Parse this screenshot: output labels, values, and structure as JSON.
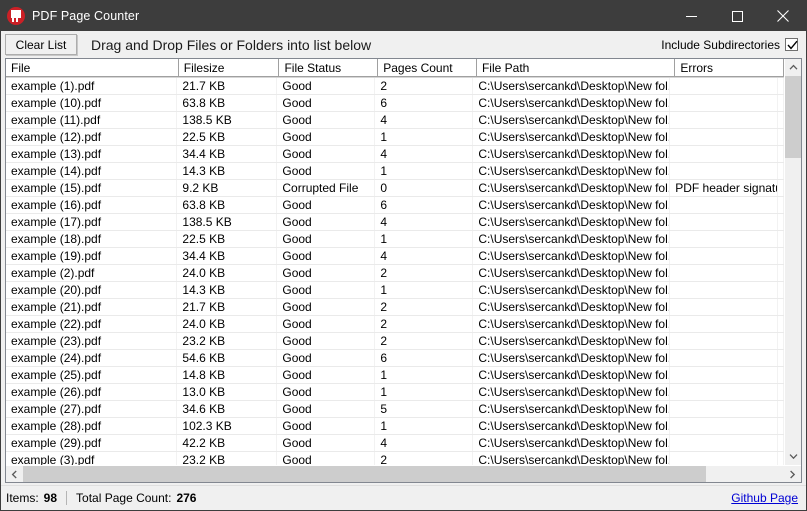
{
  "window": {
    "title": "PDF Page Counter",
    "app_icon": "pdf-document-icon",
    "controls": {
      "minimize": "minimize-icon",
      "maximize": "maximize-icon",
      "close": "close-icon"
    }
  },
  "toolbar": {
    "clear_list_label": "Clear List",
    "drop_hint": "Drag and Drop Files or Folders into list below",
    "include_subdirectories_label": "Include Subdirectories",
    "include_subdirectories_checked": true
  },
  "table": {
    "columns": [
      "File",
      "Filesize",
      "File Status",
      "Pages Count",
      "File Path",
      "Errors"
    ],
    "rows": [
      [
        "example (1).pdf",
        "21.7 KB",
        "Good",
        "2",
        "C:\\Users\\sercankd\\Desktop\\New fol...",
        ""
      ],
      [
        "example (10).pdf",
        "63.8 KB",
        "Good",
        "6",
        "C:\\Users\\sercankd\\Desktop\\New fol...",
        ""
      ],
      [
        "example (11).pdf",
        "138.5 KB",
        "Good",
        "4",
        "C:\\Users\\sercankd\\Desktop\\New fol...",
        ""
      ],
      [
        "example (12).pdf",
        "22.5 KB",
        "Good",
        "1",
        "C:\\Users\\sercankd\\Desktop\\New fol...",
        ""
      ],
      [
        "example (13).pdf",
        "34.4 KB",
        "Good",
        "4",
        "C:\\Users\\sercankd\\Desktop\\New fol...",
        ""
      ],
      [
        "example (14).pdf",
        "14.3 KB",
        "Good",
        "1",
        "C:\\Users\\sercankd\\Desktop\\New fol...",
        ""
      ],
      [
        "example (15).pdf",
        "9.2 KB",
        "Corrupted File",
        "0",
        "C:\\Users\\sercankd\\Desktop\\New fol...",
        "PDF header signature"
      ],
      [
        "example (16).pdf",
        "63.8 KB",
        "Good",
        "6",
        "C:\\Users\\sercankd\\Desktop\\New fol...",
        ""
      ],
      [
        "example (17).pdf",
        "138.5 KB",
        "Good",
        "4",
        "C:\\Users\\sercankd\\Desktop\\New fol...",
        ""
      ],
      [
        "example (18).pdf",
        "22.5 KB",
        "Good",
        "1",
        "C:\\Users\\sercankd\\Desktop\\New fol...",
        ""
      ],
      [
        "example (19).pdf",
        "34.4 KB",
        "Good",
        "4",
        "C:\\Users\\sercankd\\Desktop\\New fol...",
        ""
      ],
      [
        "example (2).pdf",
        "24.0 KB",
        "Good",
        "2",
        "C:\\Users\\sercankd\\Desktop\\New fol...",
        ""
      ],
      [
        "example (20).pdf",
        "14.3 KB",
        "Good",
        "1",
        "C:\\Users\\sercankd\\Desktop\\New fol...",
        ""
      ],
      [
        "example (21).pdf",
        "21.7 KB",
        "Good",
        "2",
        "C:\\Users\\sercankd\\Desktop\\New fol...",
        ""
      ],
      [
        "example (22).pdf",
        "24.0 KB",
        "Good",
        "2",
        "C:\\Users\\sercankd\\Desktop\\New fol...",
        ""
      ],
      [
        "example (23).pdf",
        "23.2 KB",
        "Good",
        "2",
        "C:\\Users\\sercankd\\Desktop\\New fol...",
        ""
      ],
      [
        "example (24).pdf",
        "54.6 KB",
        "Good",
        "6",
        "C:\\Users\\sercankd\\Desktop\\New fol...",
        ""
      ],
      [
        "example (25).pdf",
        "14.8 KB",
        "Good",
        "1",
        "C:\\Users\\sercankd\\Desktop\\New fol...",
        ""
      ],
      [
        "example (26).pdf",
        "13.0 KB",
        "Good",
        "1",
        "C:\\Users\\sercankd\\Desktop\\New fol...",
        ""
      ],
      [
        "example (27).pdf",
        "34.6 KB",
        "Good",
        "5",
        "C:\\Users\\sercankd\\Desktop\\New fol...",
        ""
      ],
      [
        "example (28).pdf",
        "102.3 KB",
        "Good",
        "1",
        "C:\\Users\\sercankd\\Desktop\\New fol...",
        ""
      ],
      [
        "example (29).pdf",
        "42.2 KB",
        "Good",
        "4",
        "C:\\Users\\sercankd\\Desktop\\New fol...",
        ""
      ],
      [
        "example (3).pdf",
        "23.2 KB",
        "Good",
        "2",
        "C:\\Users\\sercankd\\Desktop\\New fol...",
        ""
      ]
    ]
  },
  "statusbar": {
    "items_label": "Items:",
    "items_value": "98",
    "pages_label": "Total Page Count:",
    "pages_value": "276",
    "github_link": "Github Page"
  },
  "colors": {
    "titlebar": "#3d3d3d",
    "accent_icon": "#cc2026",
    "link": "#0000d4",
    "scroll_thumb": "#cdcdcd"
  }
}
